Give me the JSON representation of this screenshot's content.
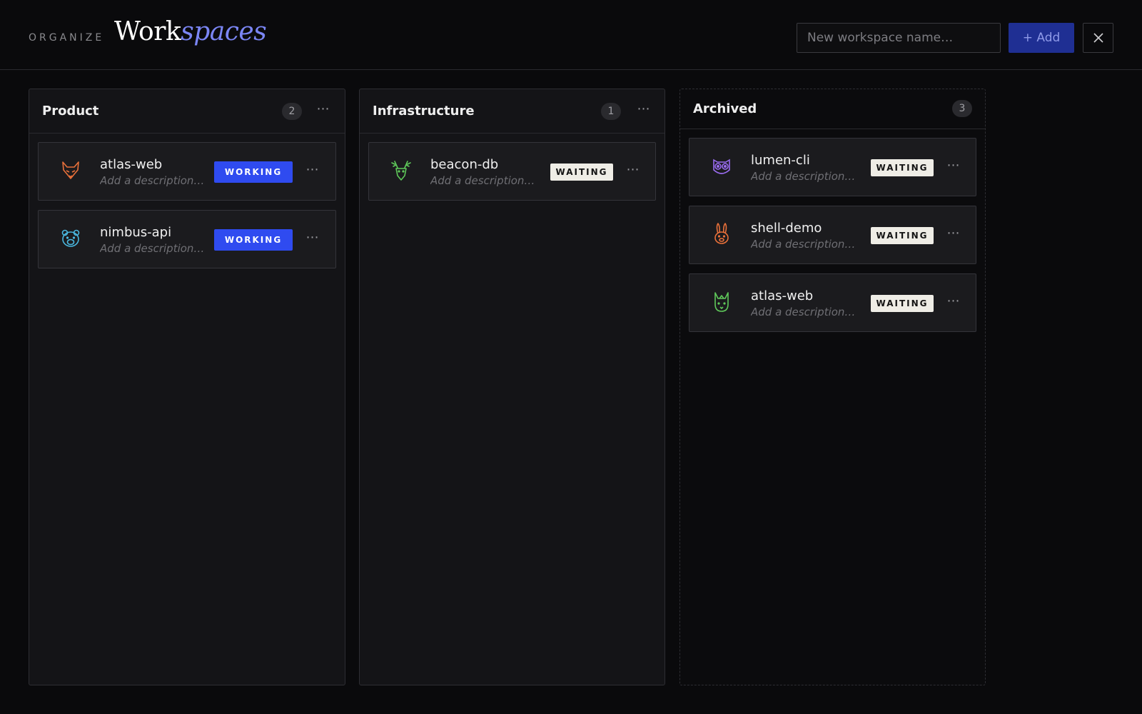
{
  "header": {
    "eyebrow": "ORGANIZE",
    "title_main": "Work",
    "title_accent": "spaces",
    "input_placeholder": "New workspace name…",
    "add_label": "+ Add",
    "close_icon": "close-icon"
  },
  "colors": {
    "background": "#0a0a0c",
    "accent": "#7b86f5",
    "working_badge": "#2f4bf0",
    "waiting_badge": "#efede6",
    "add_button": "#1f2f93"
  },
  "columns": [
    {
      "title": "Product",
      "count": "2",
      "cards": [
        {
          "name": "atlas-web",
          "description": "Add a description…",
          "status": "WORKING",
          "icon": "fox-icon",
          "icon_color": "#e8703a"
        },
        {
          "name": "nimbus-api",
          "description": "Add a description…",
          "status": "WORKING",
          "icon": "bear-icon",
          "icon_color": "#4ab8e0"
        }
      ]
    },
    {
      "title": "Infrastructure",
      "count": "1",
      "cards": [
        {
          "name": "beacon-db",
          "description": "Add a description…",
          "status": "WAITING",
          "icon": "deer-icon",
          "icon_color": "#5fc95a"
        }
      ]
    },
    {
      "title": "Archived",
      "count": "3",
      "cards": [
        {
          "name": "lumen-cli",
          "description": "Add a description…",
          "status": "WAITING",
          "icon": "owl-icon",
          "icon_color": "#9a6cf0"
        },
        {
          "name": "shell-demo",
          "description": "Add a description…",
          "status": "WAITING",
          "icon": "rabbit-icon",
          "icon_color": "#e8703a"
        },
        {
          "name": "atlas-web",
          "description": "Add a description…",
          "status": "WAITING",
          "icon": "cat-icon",
          "icon_color": "#5fc95a"
        }
      ]
    }
  ],
  "menu_glyph": "⋯"
}
